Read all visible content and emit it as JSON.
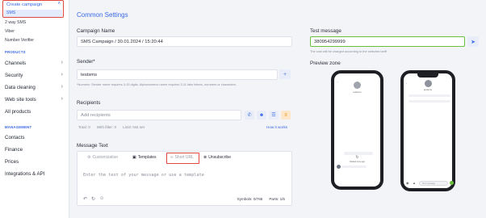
{
  "sidebar": {
    "create_campaign": "Create campaign",
    "sub_items": [
      "SMS",
      "2 way SMS",
      "Viber",
      "Number Verifier"
    ],
    "products_header": "PRODUCTS",
    "products": [
      "Channels",
      "Security",
      "Data cleaning",
      "Web site tools",
      "All products"
    ],
    "management_header": "MANAGEMENT",
    "management": [
      "Contacts",
      "Finance",
      "Prices",
      "Integrations & API"
    ]
  },
  "common": {
    "heading": "Common Settings",
    "campaign_name_label": "Campaign Name",
    "campaign_name_value": "SMS Campaign / 30.01.2024 / 15:20:44",
    "sender_label": "Sender*",
    "sender_value": "testsms",
    "sender_hint": "*Numeric: Sender name requires 3-15 digits. Alphanumeric name requires 3-11 latin letters, numbers or characters.",
    "recipients_label": "Recipients",
    "recipients_placeholder": "Add recipients",
    "total": "Total: 0",
    "with_filter": "With filter: 0",
    "limit": "Limit: Not set",
    "how_it_works": "How it works",
    "message_text_label": "Message Text"
  },
  "message": {
    "tabs": [
      "Customization",
      "Templates",
      "Short URL",
      "Unsubscribe"
    ],
    "placeholder": "Enter the text of your message or use a template",
    "symbols": "Symbols: 0/765",
    "parts": "Parts: 1/5"
  },
  "test": {
    "label": "Test message",
    "value": "380954299999",
    "hint": "The cost will be charged according to the selected tariff",
    "preview_label": "Preview zone"
  },
  "phones": {
    "contact_name": "testsms",
    "android_caption": "Default sms app",
    "input_placeholder": "Text message"
  },
  "colors": {
    "accent": "#3a68e6",
    "highlight": "#e0473f",
    "valid": "#6abf3d"
  }
}
